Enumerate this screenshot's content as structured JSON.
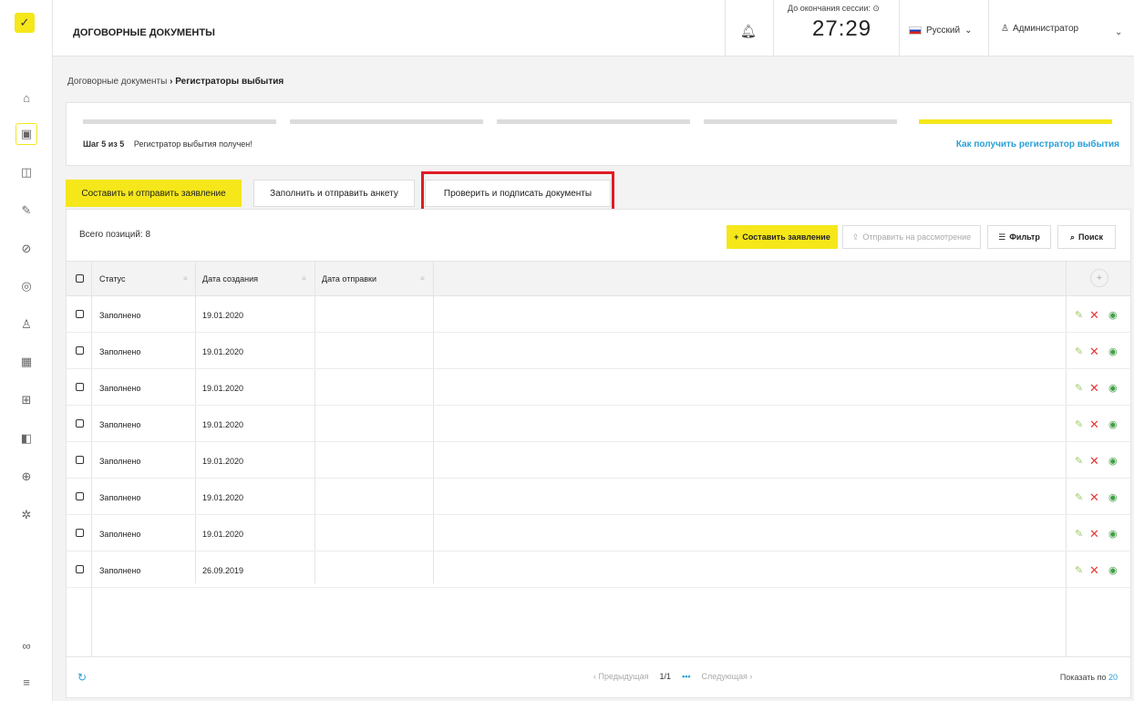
{
  "sidebar": {
    "logo_icon": "check-logo-icon",
    "icons": [
      "home-icon",
      "briefcase-icon",
      "folder-icon",
      "tool-icon",
      "link-icon",
      "fingerprint-icon",
      "user-icon",
      "chip-icon",
      "grid-icon",
      "archive-icon",
      "globe-icon",
      "settings-icon"
    ],
    "bottom_icons": [
      "link-chain-icon",
      "menu-icon"
    ]
  },
  "header": {
    "title": "ДОГОВОРНЫЕ ДОКУМЕНТЫ",
    "session_label": "До окончания сессии: ⊙",
    "session_time": "27:29",
    "language": "Русский",
    "user": "Администратор"
  },
  "breadcrumb": {
    "parent": "Договорные документы",
    "separator": "›",
    "current": "Регистраторы выбытия"
  },
  "stepper": {
    "step_label": "Шаг 5 из 5",
    "step_text": "Регистратор выбытия получен!",
    "help_link": "Как получить регистратор выбытия",
    "steps_total": 5,
    "current_step": 5
  },
  "tabs": [
    {
      "label": "Составить и отправить заявление"
    },
    {
      "label": "Заполнить и отправить анкету"
    },
    {
      "label": "Проверить и подписать документы"
    }
  ],
  "toolbar": {
    "total": "Всего позиций: 8",
    "compose": "Составить заявление",
    "send": "Отправить на рассмотрение",
    "filter": "Фильтр",
    "search": "Поиск"
  },
  "table": {
    "columns": [
      "Статус",
      "Дата создания",
      "Дата отправки"
    ],
    "rows": [
      {
        "status": "Заполнено",
        "created": "19.01.2020",
        "sent": ""
      },
      {
        "status": "Заполнено",
        "created": "19.01.2020",
        "sent": ""
      },
      {
        "status": "Заполнено",
        "created": "19.01.2020",
        "sent": ""
      },
      {
        "status": "Заполнено",
        "created": "19.01.2020",
        "sent": ""
      },
      {
        "status": "Заполнено",
        "created": "19.01.2020",
        "sent": ""
      },
      {
        "status": "Заполнено",
        "created": "19.01.2020",
        "sent": ""
      },
      {
        "status": "Заполнено",
        "created": "19.01.2020",
        "sent": ""
      },
      {
        "status": "Заполнено",
        "created": "26.09.2019",
        "sent": ""
      }
    ]
  },
  "pagination": {
    "prev": "‹ Предыдущая",
    "page": "1/1",
    "dots": "•••",
    "next": "Следующая ›",
    "show_by_label": "Показать по",
    "show_by_value": "20"
  },
  "colors": {
    "accent": "#f5e71a",
    "link": "#2a9fd6",
    "danger": "#e53935",
    "highlight": "#e11b22"
  }
}
